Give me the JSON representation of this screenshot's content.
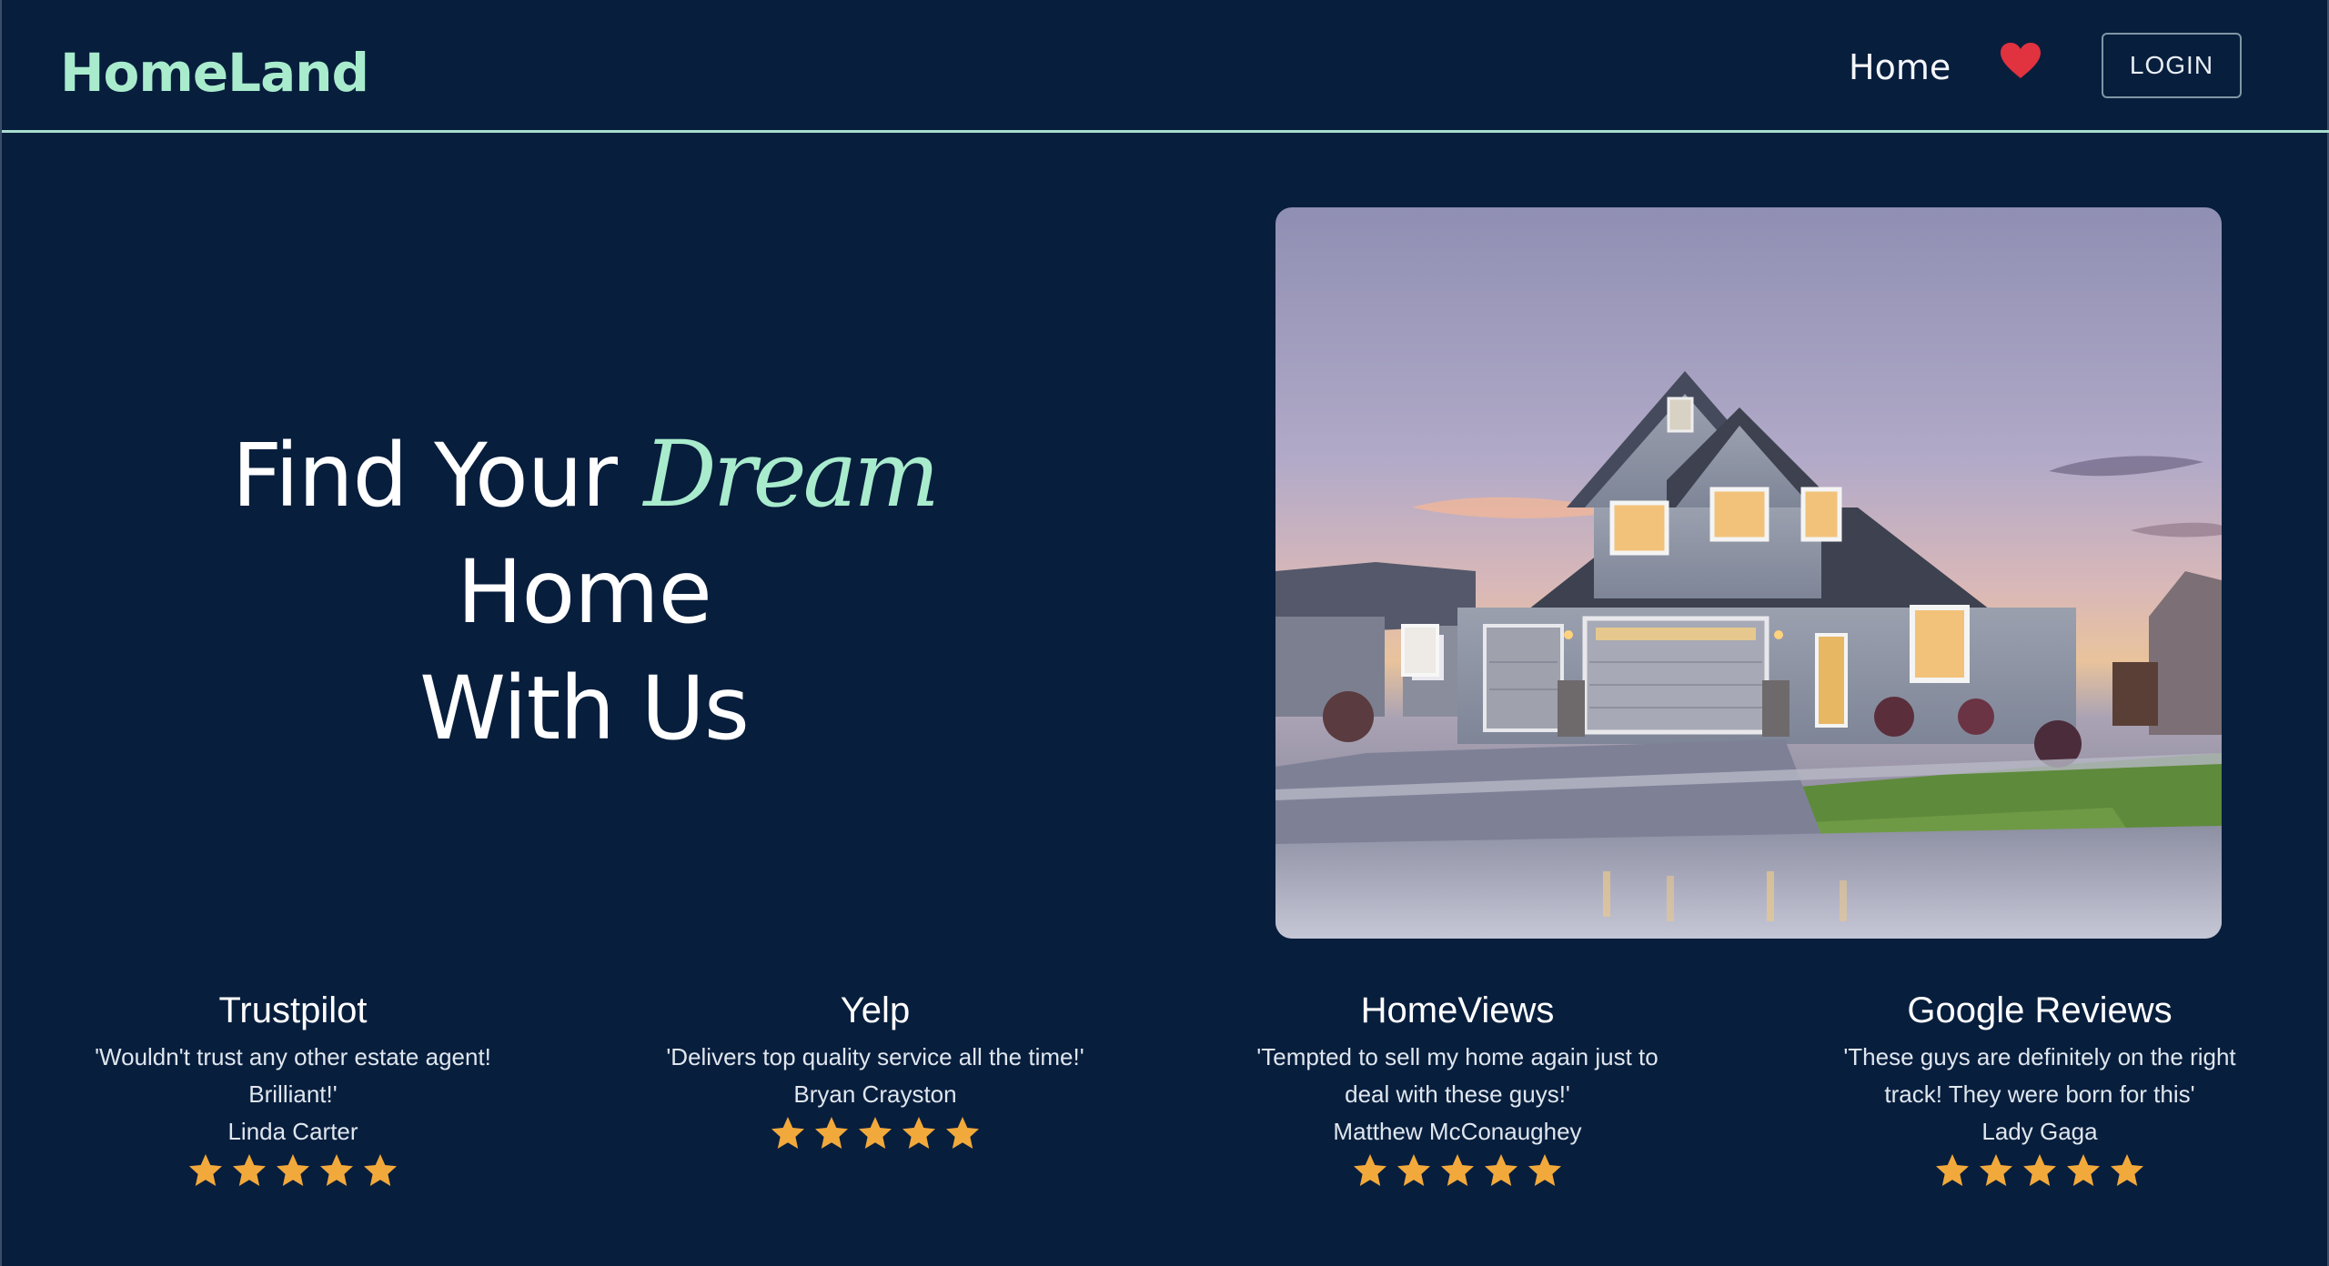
{
  "navbar": {
    "brand": "HomeLand",
    "home_label": "Home",
    "heart_icon": "heart-icon",
    "login_label": "LOGIN"
  },
  "hero": {
    "title_part1": "Find Your ",
    "title_highlight": "Dream",
    "title_part2": " Home",
    "title_line2": "With Us",
    "image_alt": "house photo"
  },
  "reviews": [
    {
      "source": "Trustpilot",
      "quote": "'Wouldn't trust any other estate agent! Brilliant!'",
      "author": "Linda Carter",
      "rating": 5
    },
    {
      "source": "Yelp",
      "quote": "'Delivers top quality service all the time!'",
      "author": "Bryan Crayston",
      "rating": 5
    },
    {
      "source": "HomeViews",
      "quote": "'Tempted to sell my home again just to deal with these guys!'",
      "author": "Matthew McConaughey",
      "rating": 5
    },
    {
      "source": "Google Reviews",
      "quote": "'These guys are definitely on the right track! They were born for this'",
      "author": "Lady Gaga",
      "rating": 5
    }
  ],
  "colors": {
    "background": "#081e3d",
    "accent": "#a8eccd",
    "heart": "#e0323f",
    "star": "#f2a93b"
  }
}
